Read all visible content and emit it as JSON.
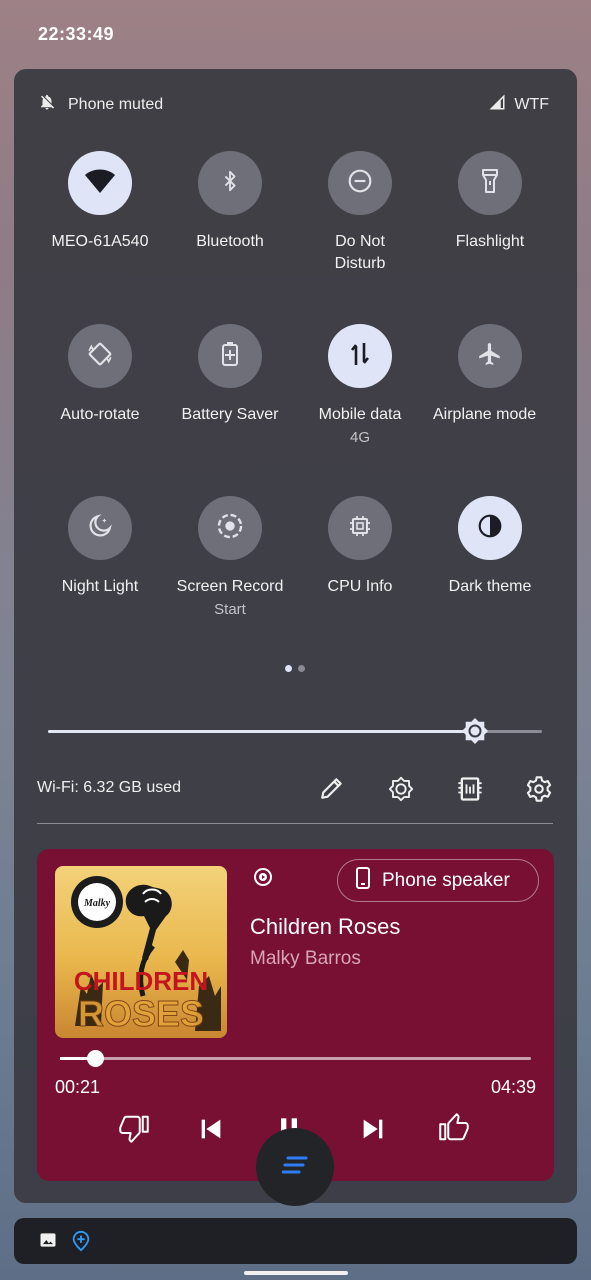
{
  "status_bar": {
    "time": "22:33:49"
  },
  "header": {
    "muted_label": "Phone muted",
    "carrier": "WTF"
  },
  "tiles": [
    {
      "label": "MEO-61A540",
      "sub": "",
      "icon": "wifi-icon",
      "on": true
    },
    {
      "label": "Bluetooth",
      "sub": "",
      "icon": "bluetooth-icon",
      "on": false
    },
    {
      "label": "Do Not",
      "label2": "Disturb",
      "sub": "",
      "icon": "dnd-icon",
      "on": false
    },
    {
      "label": "Flashlight",
      "sub": "",
      "icon": "flashlight-icon",
      "on": false
    },
    {
      "label": "Auto-rotate",
      "sub": "",
      "icon": "auto-rotate-icon",
      "on": false
    },
    {
      "label": "Battery Saver",
      "sub": "",
      "icon": "battery-saver-icon",
      "on": false
    },
    {
      "label": "Mobile data",
      "sub": "4G",
      "icon": "mobile-data-icon",
      "on": true
    },
    {
      "label": "Airplane mode",
      "sub": "",
      "icon": "airplane-icon",
      "on": false
    },
    {
      "label": "Night Light",
      "sub": "",
      "icon": "night-light-icon",
      "on": false
    },
    {
      "label": "Screen Record",
      "sub": "Start",
      "icon": "screen-record-icon",
      "on": false
    },
    {
      "label": "CPU Info",
      "sub": "",
      "icon": "cpu-icon",
      "on": false
    },
    {
      "label": "Dark theme",
      "sub": "",
      "icon": "dark-theme-icon",
      "on": true
    }
  ],
  "pager": {
    "pages": 2,
    "current": 1
  },
  "brightness": {
    "level": 0.86
  },
  "footer": {
    "data_usage": "Wi-Fi: 6.32 GB used"
  },
  "media": {
    "output_device": "Phone speaker",
    "title": "Children Roses",
    "artist": "Malky Barros",
    "elapsed": "00:21",
    "duration": "04:39",
    "progress": 0.075,
    "art_logo_text": "Malky",
    "art_text_line1": "CHILDREN",
    "art_text_line2": "ROSES"
  },
  "colors": {
    "panel": "#3a3a42",
    "tile_on": "#dfe4f6",
    "tile_off": "#6f6f7a",
    "media_bg": "#771033",
    "accent_blue": "#2f7df6"
  }
}
